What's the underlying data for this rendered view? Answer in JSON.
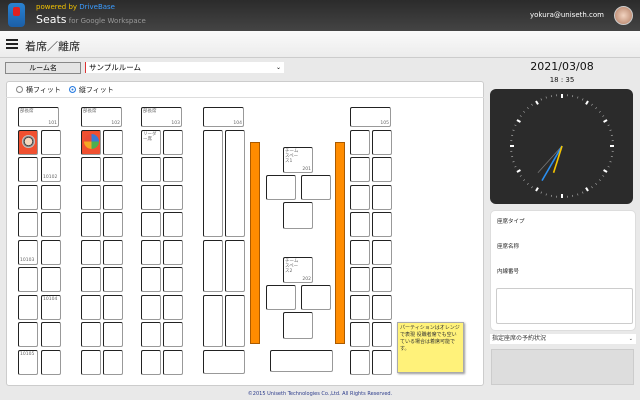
{
  "header": {
    "powered_prefix": "powered by ",
    "powered_brand": "DriveBase",
    "app_name": "Seats",
    "app_suffix": " for Google Workspace",
    "user_email": "yokura@uniseth.com"
  },
  "page": {
    "title": "着席／離席"
  },
  "room": {
    "label": "ルーム名",
    "selected": "サンプルルーム"
  },
  "fit": {
    "options": [
      {
        "label": "横フィット",
        "checked": false
      },
      {
        "label": "縦フィット",
        "checked": true
      }
    ]
  },
  "seats": {
    "headers": [
      {
        "top": "部長席",
        "num": "101"
      },
      {
        "top": "部長席",
        "num": "102"
      },
      {
        "top": "部長席",
        "num": "103"
      },
      {
        "top": "",
        "num": "104"
      },
      {
        "top": "",
        "num": "105"
      }
    ],
    "leader_seat": "リーダー席",
    "numbered": [
      "10102",
      "10103",
      "10104",
      "10105"
    ],
    "team_spaces": [
      {
        "name": "チームスペース1",
        "num": "201"
      },
      {
        "name": "チームスペース2",
        "num": "202"
      }
    ],
    "occupied": [
      {
        "group": 1,
        "avatar": "user-photo"
      },
      {
        "group": 2,
        "avatar": "group-logo"
      }
    ]
  },
  "note": "パーティションはオレンジで表現 役職者席でも空いている場合は着席可能です。",
  "colors": {
    "partition": "#ff8c00",
    "occupied": "#f05030",
    "note": "#fff27a"
  },
  "clock": {
    "date": "2021/03/08",
    "time": "18 : 35",
    "hour": 18,
    "minute": 35,
    "second": 37
  },
  "info": {
    "seat_type_label": "座席タイプ",
    "seat_name_label": "座席名称",
    "extension_label": "内線番号"
  },
  "reservation": {
    "selected": "指定座席の予約状況"
  },
  "footer": "©2015 Uniseth Technologies Co.,Ltd. All Rights Reserved."
}
